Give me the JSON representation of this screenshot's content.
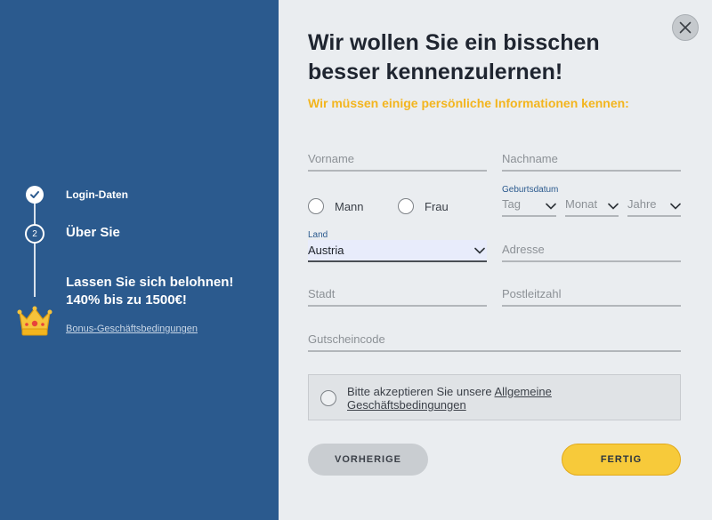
{
  "sidebar": {
    "steps": [
      {
        "label": "Login-Daten",
        "state": "done"
      },
      {
        "number": "2",
        "label": "Über Sie",
        "state": "active"
      }
    ],
    "bonus_text": "Lassen Sie sich belohnen! 140% bis zu 1500€!",
    "bonus_link": "Bonus-Geschäftsbedingungen"
  },
  "form": {
    "title": "Wir wollen Sie ein bisschen besser kennenzulernen!",
    "subtitle": "Wir müssen einige persönliche Informationen kennen:",
    "first_name_placeholder": "Vorname",
    "last_name_placeholder": "Nachname",
    "gender_options": [
      "Mann",
      "Frau"
    ],
    "birthdate_label": "Geburtsdatum",
    "birthdate_day": "Tag",
    "birthdate_month": "Monat",
    "birthdate_year": "Jahre",
    "country_label": "Land",
    "country_value": "Austria",
    "address_placeholder": "Adresse",
    "city_placeholder": "Stadt",
    "zip_placeholder": "Postleitzahl",
    "voucher_placeholder": "Gutscheincode",
    "terms_text": "Bitte akzeptieren Sie unsere",
    "terms_link": "Allgemeine Geschäftsbedingungen"
  },
  "buttons": {
    "prev": "VORHERIGE",
    "done": "FERTIG"
  },
  "colors": {
    "sidebar_bg": "#2b5a8e",
    "accent_yellow": "#f7ca3a",
    "subtitle_yellow": "#f3b51e"
  },
  "icons": {
    "close": "close-icon",
    "check": "check-icon",
    "crown": "crown-icon",
    "chevron": "chevron-down-icon"
  }
}
